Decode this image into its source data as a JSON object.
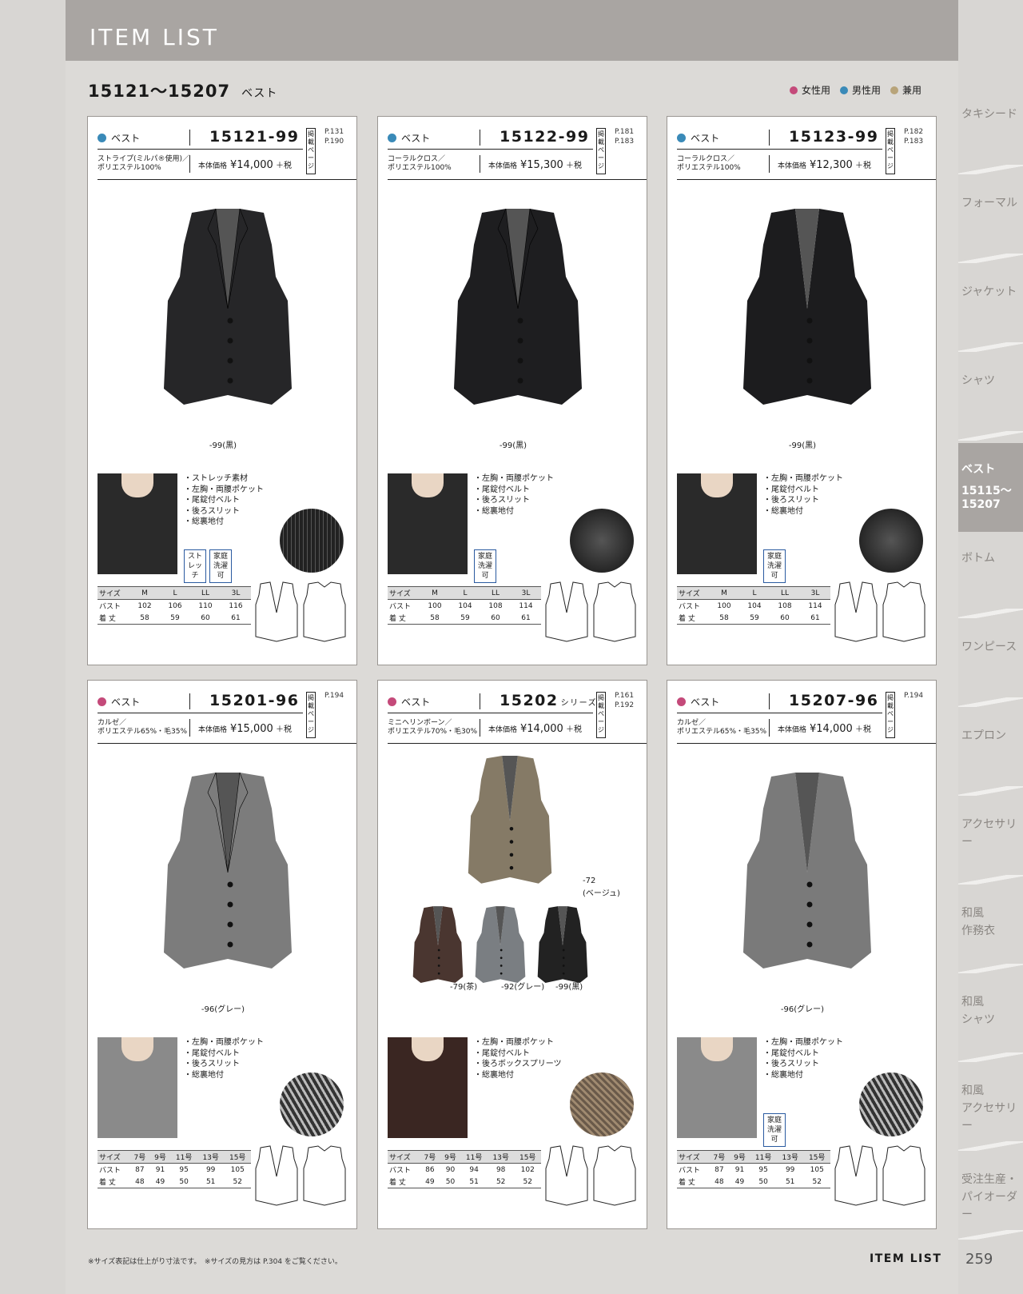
{
  "header": {
    "title": "ITEM LIST"
  },
  "section": {
    "range": "15121～15207",
    "category": "ベスト"
  },
  "legend": [
    {
      "label": "女性用",
      "color": "#c44a7a"
    },
    {
      "label": "男性用",
      "color": "#3a8ab8"
    },
    {
      "label": "兼用",
      "color": "#b8a47a"
    }
  ],
  "cards": [
    {
      "category": "ベスト",
      "code": "15121-99",
      "series": "",
      "pages": [
        "P.131",
        "P.190"
      ],
      "page_label": "掲載ページ",
      "material": [
        "ストライプ(ミルパ®使用)／",
        "ポリエステル100%"
      ],
      "price_label": "本体価格",
      "price": "¥14,000",
      "tax": "＋税",
      "color_labels": [
        "-99(黒)"
      ],
      "features": [
        "・ストレッチ素材",
        "・左胸・両腰ポケット",
        "・尾錠付ベルト",
        "・後ろスリット",
        "・総裏地付"
      ],
      "badges": [
        "ストレッチ",
        "家庭洗濯可"
      ],
      "size_rows": [
        [
          "サイズ",
          "M",
          "L",
          "LL",
          "3L"
        ],
        [
          "バスト",
          "102",
          "106",
          "110",
          "116"
        ],
        [
          "着 丈",
          "58",
          "59",
          "60",
          "61"
        ]
      ],
      "dot_color": "#3a8ab8",
      "vest_color": "#262628"
    },
    {
      "category": "ベスト",
      "code": "15122-99",
      "series": "",
      "pages": [
        "P.181",
        "P.183"
      ],
      "page_label": "掲載ページ",
      "material": [
        "コーラルクロス／",
        "ポリエステル100%"
      ],
      "price_label": "本体価格",
      "price": "¥15,300",
      "tax": "＋税",
      "color_labels": [
        "-99(黒)"
      ],
      "features": [
        "・左胸・両腰ポケット",
        "・尾錠付ベルト",
        "・後ろスリット",
        "・総裏地付"
      ],
      "badges": [
        "家庭洗濯可"
      ],
      "size_rows": [
        [
          "サイズ",
          "M",
          "L",
          "LL",
          "3L"
        ],
        [
          "バスト",
          "100",
          "104",
          "108",
          "114"
        ],
        [
          "着 丈",
          "58",
          "59",
          "60",
          "61"
        ]
      ],
      "dot_color": "#3a8ab8",
      "vest_color": "#1e1e20"
    },
    {
      "category": "ベスト",
      "code": "15123-99",
      "series": "",
      "pages": [
        "P.182",
        "P.183"
      ],
      "page_label": "掲載ページ",
      "material": [
        "コーラルクロス／",
        "ポリエステル100%"
      ],
      "price_label": "本体価格",
      "price": "¥12,300",
      "tax": "＋税",
      "color_labels": [
        "-99(黒)"
      ],
      "features": [
        "・左胸・両腰ポケット",
        "・尾錠付ベルト",
        "・後ろスリット",
        "・総裏地付"
      ],
      "badges": [
        "家庭洗濯可"
      ],
      "size_rows": [
        [
          "サイズ",
          "M",
          "L",
          "LL",
          "3L"
        ],
        [
          "バスト",
          "100",
          "104",
          "108",
          "114"
        ],
        [
          "着 丈",
          "58",
          "59",
          "60",
          "61"
        ]
      ],
      "dot_color": "#3a8ab8",
      "vest_color": "#1c1c1e"
    },
    {
      "category": "ベスト",
      "code": "15201-96",
      "series": "",
      "pages": [
        "P.194"
      ],
      "page_label": "掲載ページ",
      "material": [
        "カルゼ／",
        "ポリエステル65%・毛35%"
      ],
      "price_label": "本体価格",
      "price": "¥15,000",
      "tax": "＋税",
      "color_labels": [
        "-96(グレー)"
      ],
      "features": [
        "・左胸・両腰ポケット",
        "・尾錠付ベルト",
        "・後ろスリット",
        "・総裏地付"
      ],
      "badges": [],
      "size_rows": [
        [
          "サイズ",
          "7号",
          "9号",
          "11号",
          "13号",
          "15号"
        ],
        [
          "バスト",
          "87",
          "91",
          "95",
          "99",
          "105"
        ],
        [
          "着 丈",
          "48",
          "49",
          "50",
          "51",
          "52"
        ]
      ],
      "dot_color": "#c44a7a",
      "vest_color": "#7c7c7c"
    },
    {
      "category": "ベスト",
      "code": "15202",
      "series": "シリーズ",
      "pages": [
        "P.161",
        "P.192"
      ],
      "page_label": "掲載ページ",
      "material": [
        "ミニヘリンボーン／",
        "ポリエステル70%・毛30%"
      ],
      "price_label": "本体価格",
      "price": "¥14,000",
      "tax": "＋税",
      "color_labels": [
        "-72",
        "(ベージュ)",
        "-79(茶)",
        "-92(グレー)",
        "-99(黒)"
      ],
      "features": [
        "・左胸・両腰ポケット",
        "・尾錠付ベルト",
        "・後ろボックスプリーツ",
        "・総裏地付"
      ],
      "badges": [],
      "size_rows": [
        [
          "サイズ",
          "7号",
          "9号",
          "11号",
          "13号",
          "15号"
        ],
        [
          "バスト",
          "86",
          "90",
          "94",
          "98",
          "102"
        ],
        [
          "着 丈",
          "49",
          "50",
          "51",
          "52",
          "52"
        ]
      ],
      "dot_color": "#c44a7a",
      "vest_color": "#857a66"
    },
    {
      "category": "ベスト",
      "code": "15207-96",
      "series": "",
      "pages": [
        "P.194"
      ],
      "page_label": "掲載ページ",
      "material": [
        "カルゼ／",
        "ポリエステル65%・毛35%"
      ],
      "price_label": "本体価格",
      "price": "¥14,000",
      "tax": "＋税",
      "color_labels": [
        "-96(グレー)"
      ],
      "features": [
        "・左胸・両腰ポケット",
        "・尾錠付ベルト",
        "・後ろスリット",
        "・総裏地付"
      ],
      "badges": [
        "家庭洗濯可"
      ],
      "size_rows": [
        [
          "サイズ",
          "7号",
          "9号",
          "11号",
          "13号",
          "15号"
        ],
        [
          "バスト",
          "87",
          "91",
          "95",
          "99",
          "105"
        ],
        [
          "着 丈",
          "48",
          "49",
          "50",
          "51",
          "52"
        ]
      ],
      "dot_color": "#c44a7a",
      "vest_color": "#7a7a7a"
    }
  ],
  "sidebar": {
    "tabs": [
      "タキシード",
      "フォーマル",
      "ジャケット",
      "シャツ",
      "ベスト",
      "ボトム",
      "ワンピース",
      "エプロン",
      "アクセサリー",
      "和風\n作務衣",
      "和風\nシャツ",
      "和風\nアクセサリー",
      "受注生産・\nパイオーダー"
    ],
    "active_index": 4,
    "active_range": "15115～\n15207"
  },
  "footer": {
    "note": "※サイズ表記は仕上がり寸法です。　※サイズの見方は P.304 をご覧ください。",
    "label": "ITEM LIST",
    "page": "259"
  }
}
